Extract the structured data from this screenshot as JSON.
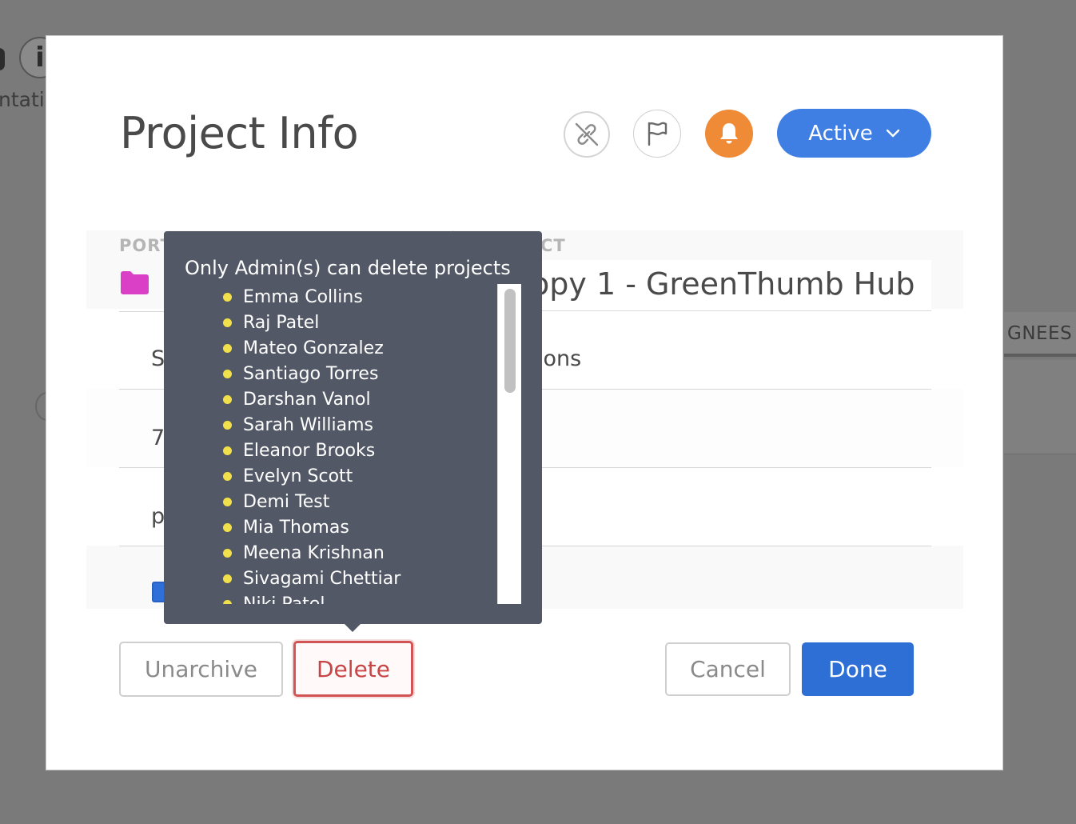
{
  "background": {
    "info_glyph": "i",
    "left_text": "ntati",
    "assignees_header": "GNEES"
  },
  "modal": {
    "title": "Project Info",
    "status": {
      "label": "Active",
      "options_icon": "chevron-down-icon"
    },
    "icons": {
      "unlink": "unlink-icon",
      "flag": "flag-icon",
      "bell": "bell-icon"
    },
    "colors": {
      "accent": "#3f7ee2",
      "bell": "#ef8a36",
      "folder": "#d940c6",
      "delete": "#c94545",
      "bullet": "#f2e04a"
    },
    "form": {
      "portfolio_label": "PORT",
      "project_label": "CT",
      "project_name": "opy 1 - GreenThumb Hub",
      "row1_left": "S",
      "row1_right": "ions",
      "row2_left": "7",
      "row3_left": "p"
    },
    "buttons": {
      "unarchive": "Unarchive",
      "delete": "Delete",
      "cancel": "Cancel",
      "done": "Done"
    }
  },
  "tooltip": {
    "title": "Only Admin(s) can delete projects",
    "admins": [
      "Emma Collins",
      "Raj Patel",
      "Mateo Gonzalez",
      "Santiago Torres",
      "Darshan Vanol",
      "Sarah Williams",
      "Eleanor Brooks",
      "Evelyn Scott",
      "Demi Test",
      "Mia Thomas",
      "Meena Krishnan",
      "Sivagami Chettiar",
      "Niki Patel"
    ]
  }
}
